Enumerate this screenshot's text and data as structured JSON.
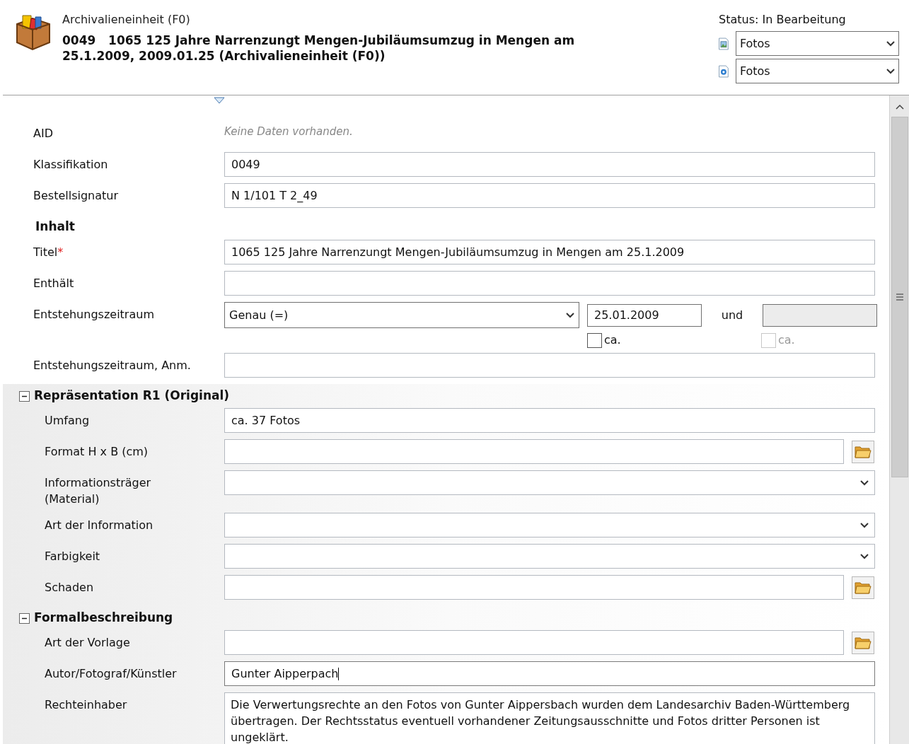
{
  "header": {
    "subtitle": "Archivalieneinheit (F0)",
    "title": "0049   1065 125 Jahre Narrenzungt Mengen-Jubiläumsumzug in Mengen am 25.1.2009, 2009.01.25 (Archivalieneinheit (F0))",
    "status": "Status: In Bearbeitung",
    "selects": [
      {
        "kind": "image",
        "value": "Fotos"
      },
      {
        "kind": "eye",
        "value": "Fotos"
      }
    ]
  },
  "sections": [
    {
      "kind": "none",
      "rows": [
        {
          "kind": "note",
          "label": "AID",
          "value": "Keine Daten vorhanden."
        },
        {
          "kind": "text",
          "label": "Klassifikation",
          "value": "0049"
        },
        {
          "kind": "text",
          "label": "Bestellsignatur",
          "value": "N 1/101 T 2_49"
        }
      ]
    },
    {
      "kind": "plain",
      "heading": "Inhalt",
      "rows": [
        {
          "kind": "text",
          "label": "Titel",
          "required_mark": "*",
          "value": "1065 125 Jahre Narrenzungt Mengen-Jubiläumsumzug in Mengen am 25.1.2009"
        },
        {
          "kind": "text",
          "label": "Enthält"
        },
        {
          "kind": "date-range",
          "label": "Entstehungszeitraum",
          "operator": "Genau (=)",
          "from": "25.01.2009",
          "between": "und",
          "to_disabled": true,
          "from_approx": {
            "label": "ca.",
            "checked": false,
            "disabled": false
          },
          "to_approx": {
            "label": "ca.",
            "checked": false,
            "disabled": true
          }
        },
        {
          "kind": "text",
          "label": "Entstehungszeitraum, Anm."
        }
      ]
    },
    {
      "kind": "collapsible",
      "expanded": true,
      "heading": "Repräsentation R1 (Original)",
      "rows": [
        {
          "kind": "text",
          "label": "Umfang",
          "value": "ca. 37 Fotos"
        },
        {
          "kind": "picker",
          "label": "Format H x B (cm)"
        },
        {
          "kind": "select",
          "label": "Informationsträger (Material)"
        },
        {
          "kind": "select",
          "label": "Art der Information"
        },
        {
          "kind": "select",
          "label": "Farbigkeit"
        },
        {
          "kind": "picker",
          "label": "Schaden"
        }
      ]
    },
    {
      "kind": "collapsible",
      "expanded": true,
      "heading": "Formalbeschreibung",
      "rows": [
        {
          "kind": "picker",
          "label": "Art der Vorlage"
        },
        {
          "kind": "text",
          "label": "Autor/Fotograf/Künstler",
          "value": "Gunter Aipperpach",
          "focused": true
        },
        {
          "kind": "textarea",
          "label": "Rechteinhaber",
          "value": "Die Verwertungsrechte an den Fotos von Gunter Aippersbach wurden dem Landesarchiv Baden-Württemberg übertragen. Der Rechtsstatus eventuell vorhandener Zeitungsausschnitte und Fotos dritter Personen ist ungeklärt."
        }
      ]
    }
  ]
}
